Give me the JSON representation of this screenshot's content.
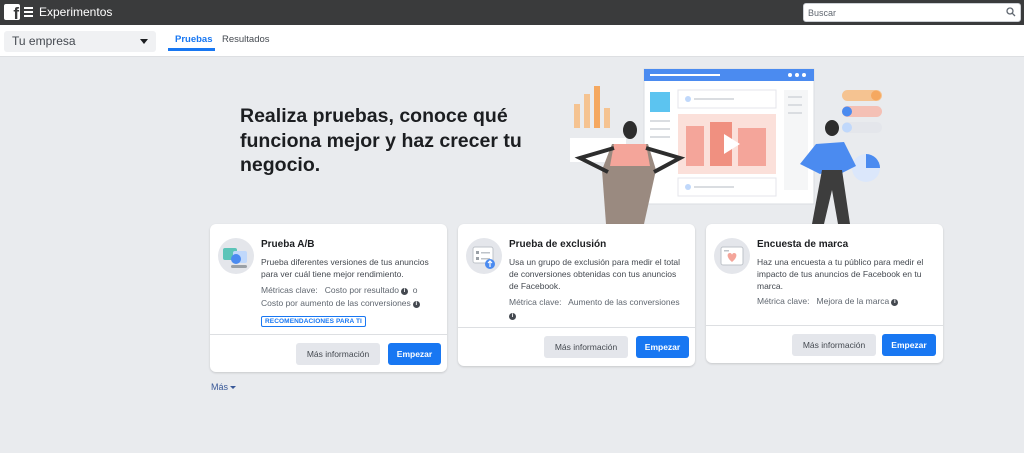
{
  "topbar": {
    "app_title": "Experimentos",
    "logo": "facebook-logo",
    "menu_icon": "hamburger-icon",
    "search_placeholder": "Buscar",
    "search_icon": "search-icon"
  },
  "subnav": {
    "account_selector": "Tu empresa",
    "tabs": [
      {
        "label": "Pruebas",
        "active": true
      },
      {
        "label": "Resultados",
        "active": false
      }
    ]
  },
  "hero": {
    "title": "Realiza pruebas, conoce qué funciona mejor y haz crecer tu negocio."
  },
  "cards": [
    {
      "title": "Prueba A/B",
      "description": "Prueba diferentes versiones de tus anuncios para ver cuál tiene mejor rendimiento.",
      "metrics_label": "Métricas clave:",
      "metric_1": "Costo por resultado",
      "metric_sep": "o",
      "metric_2": "Costo por aumento de las conversiones",
      "badge": "RECOMENDACIONES PARA TI",
      "secondary_button": "Más información",
      "primary_button": "Empezar"
    },
    {
      "title": "Prueba de exclusión",
      "description": "Usa un grupo de exclusión para medir el total de conversiones obtenidas con tus anuncios de Facebook.",
      "metrics_label": "Métrica clave:",
      "metric_1": "Aumento de las conversiones",
      "secondary_button": "Más información",
      "primary_button": "Empezar"
    },
    {
      "title": "Encuesta de marca",
      "description": "Haz una encuesta a tu público para medir el impacto de tus anuncios de Facebook en tu marca.",
      "metrics_label": "Métrica clave:",
      "metric_1": "Mejora de la marca",
      "secondary_button": "Más información",
      "primary_button": "Empezar"
    }
  ],
  "more_link": "Más",
  "colors": {
    "accent": "#1877f2",
    "topbar": "#3a3b3c",
    "background": "#e9ebee"
  }
}
